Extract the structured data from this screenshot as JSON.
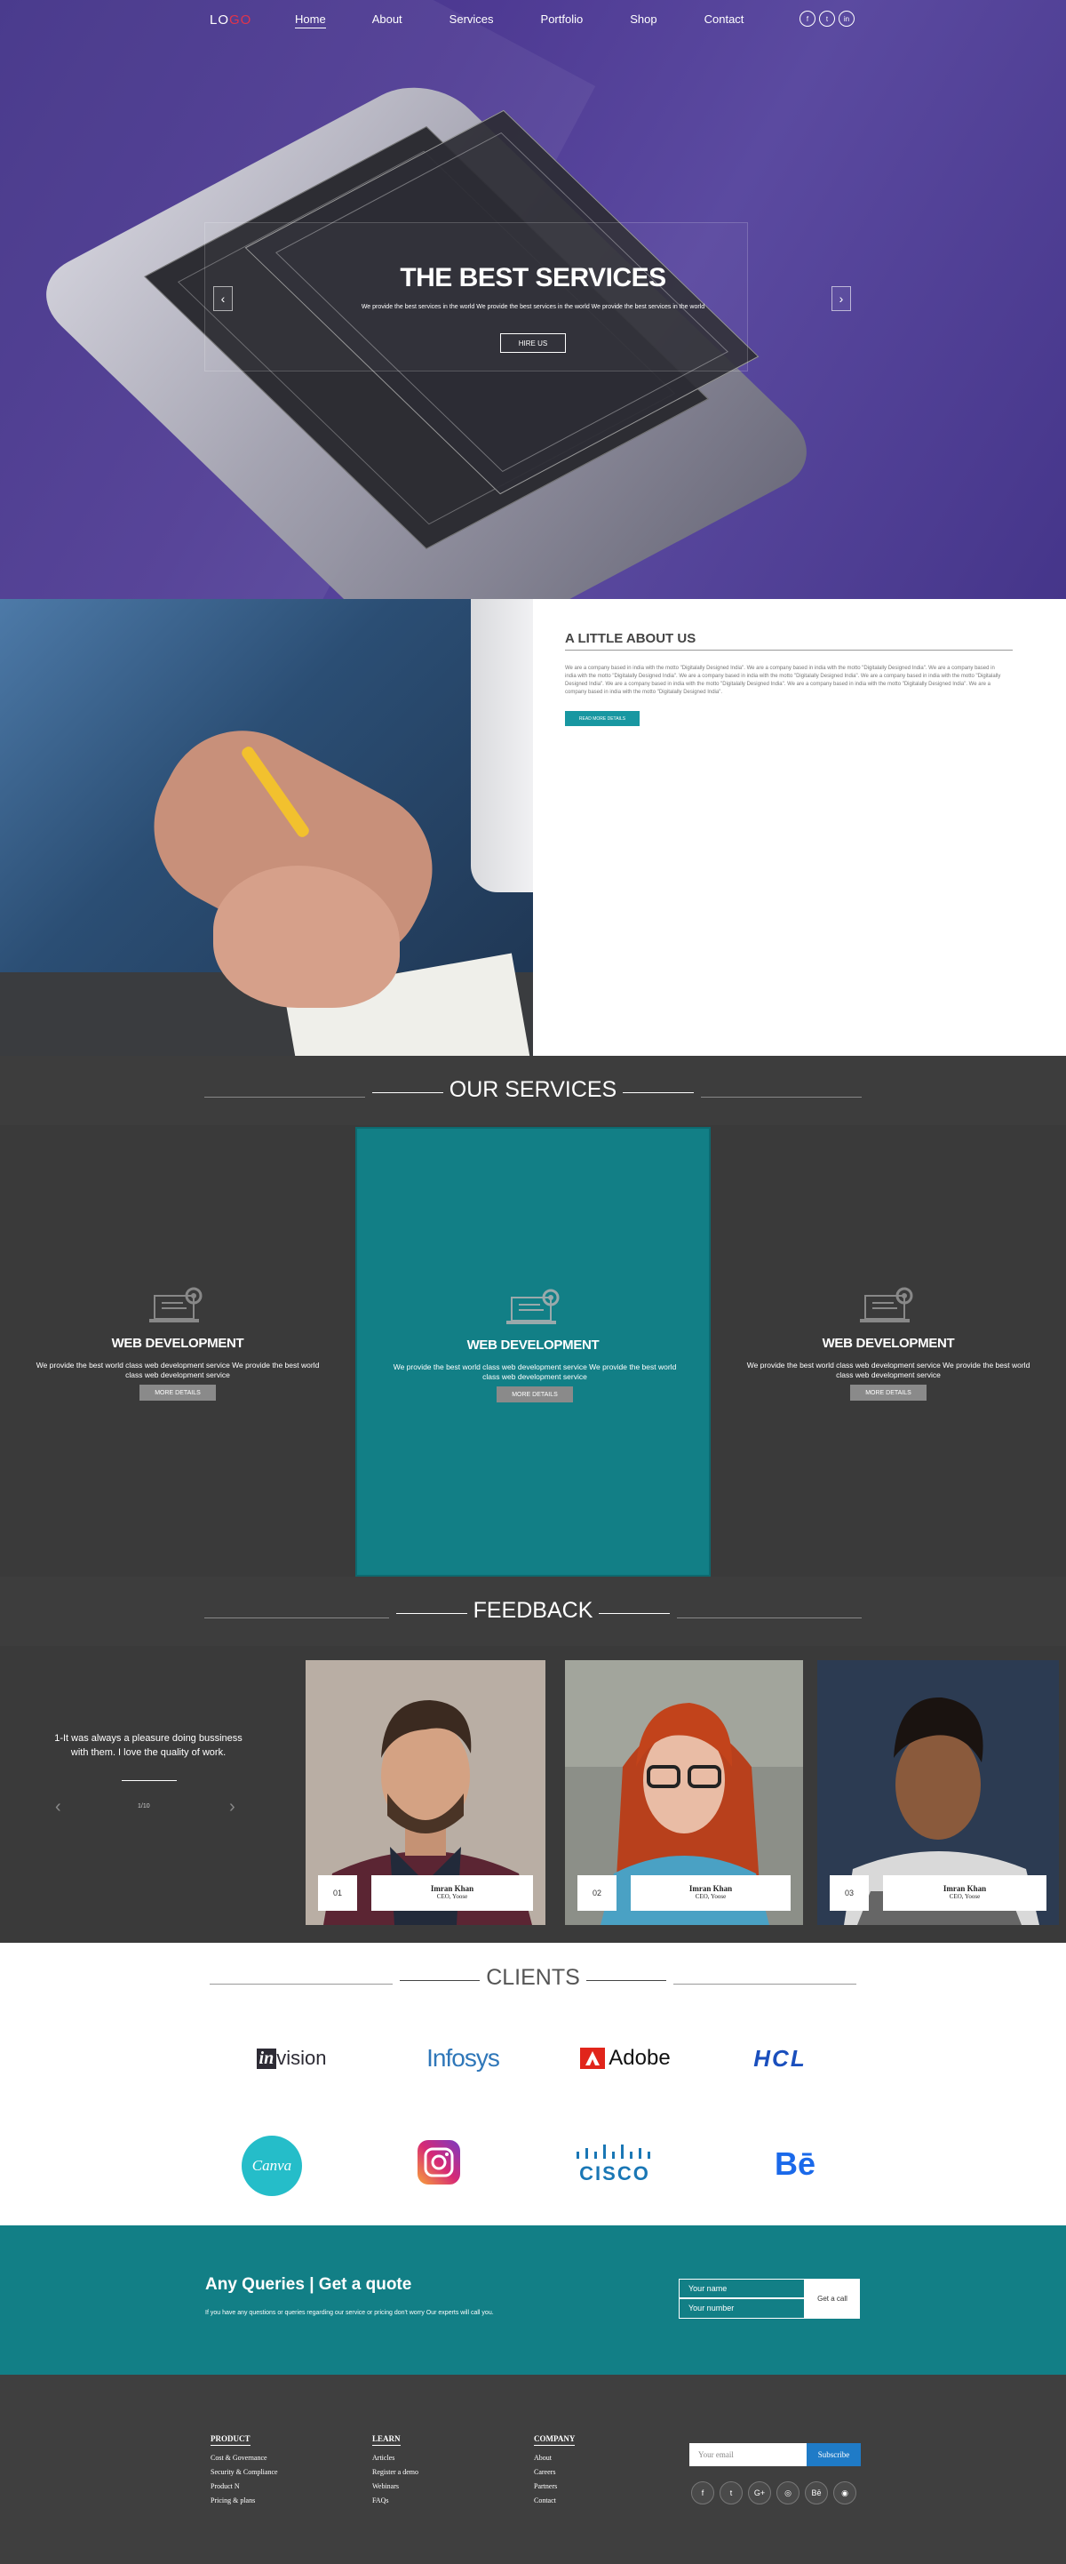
{
  "nav": {
    "logo_main": "LO",
    "logo_accent": "GO",
    "links": [
      "Home",
      "About",
      "Services",
      "Portfolio",
      "Shop",
      "Contact"
    ],
    "social": [
      "f",
      "t",
      "in"
    ]
  },
  "hero": {
    "title": "THE BEST SERVICES",
    "subtitle": "We provide the best services in the world We provide the best services in the world We provide the best services in the world",
    "button": "HIRE US",
    "prev": "‹",
    "next": "›"
  },
  "about": {
    "title": "A LITTLE ABOUT US",
    "text": "We are a company based in india with the motto \"Digitalally Designed India\". We are a company based in india with the motto \"Digitalally Designed India\". We are a company based in india with the motto \"Digitalally Designed India\". We are a company based in india with the motto \"Digitalally Designed India\". We are a company based in india with the motto \"Digitalally Designed India\". We are a company based in india with the motto \"Digitalally Designed India\". We are a company based in india with the motto \"Digitalally Designed India\". We are a company based in india with the motto \"Digitalally Designed India\".",
    "button": "READ MORE DETAILS"
  },
  "services": {
    "title": "OUR SERVICES",
    "items": [
      {
        "title": "WEB DEVELOPMENT",
        "text": "We provide the best world class web development service We provide the best world class web development service",
        "button": "MORE DETAILS"
      },
      {
        "title": "WEB DEVELOPMENT",
        "text": "We provide the best world class web development service We provide the best world class web development service",
        "button": "MORE DETAILS"
      },
      {
        "title": "WEB DEVELOPMENT",
        "text": "We provide the best world class web development service We provide the best world class web development service",
        "button": "MORE DETAILS"
      }
    ]
  },
  "feedback": {
    "title": "FEEDBACK",
    "quote": "1-It was always a pleasure doing bussiness with them. I love the quality of work.",
    "counter": "1/10",
    "cards": [
      {
        "num": "01",
        "name": "Imran Khan",
        "role": "CEO, Yoose"
      },
      {
        "num": "02",
        "name": "Imran Khan",
        "role": "CEO, Yoose"
      },
      {
        "num": "03",
        "name": "Imran Khan",
        "role": "CEO, Yoose"
      }
    ]
  },
  "clients": {
    "title": "CLIENTS",
    "logos": [
      "invision",
      "Infosys",
      "Adobe",
      "HCL",
      "Canva",
      "Instagram",
      "CISCO",
      "Bē"
    ]
  },
  "quote": {
    "title": "Any Queries | Get a quote",
    "text": "If you have any questions or queries regarding our service or pricing don't worry Our experts will call you.",
    "name_placeholder": "Your name",
    "number_placeholder": "Your number",
    "button": "Get a call"
  },
  "footer": {
    "columns": [
      {
        "title": "PRODUCT",
        "items": [
          "Cost & Governance",
          "Security & Compliance",
          "Product N",
          "Pricing & plans"
        ]
      },
      {
        "title": "LEARN",
        "items": [
          "Articles",
          "Register a demo",
          "Webinars",
          "FAQs"
        ]
      },
      {
        "title": "COMPANY",
        "items": [
          "About",
          "Careers",
          "Partners",
          "Contact"
        ]
      }
    ],
    "email_placeholder": "Your email",
    "subscribe": "Subscribe",
    "social": [
      "f",
      "t",
      "G+",
      "◎",
      "Bē",
      "◉"
    ]
  },
  "colors": {
    "teal": "#127f86",
    "hero_purple": "#4e3a93",
    "dark": "#3a3a3a",
    "logo_red": "#e3344a",
    "subscribe_blue": "#1f7bc7"
  }
}
